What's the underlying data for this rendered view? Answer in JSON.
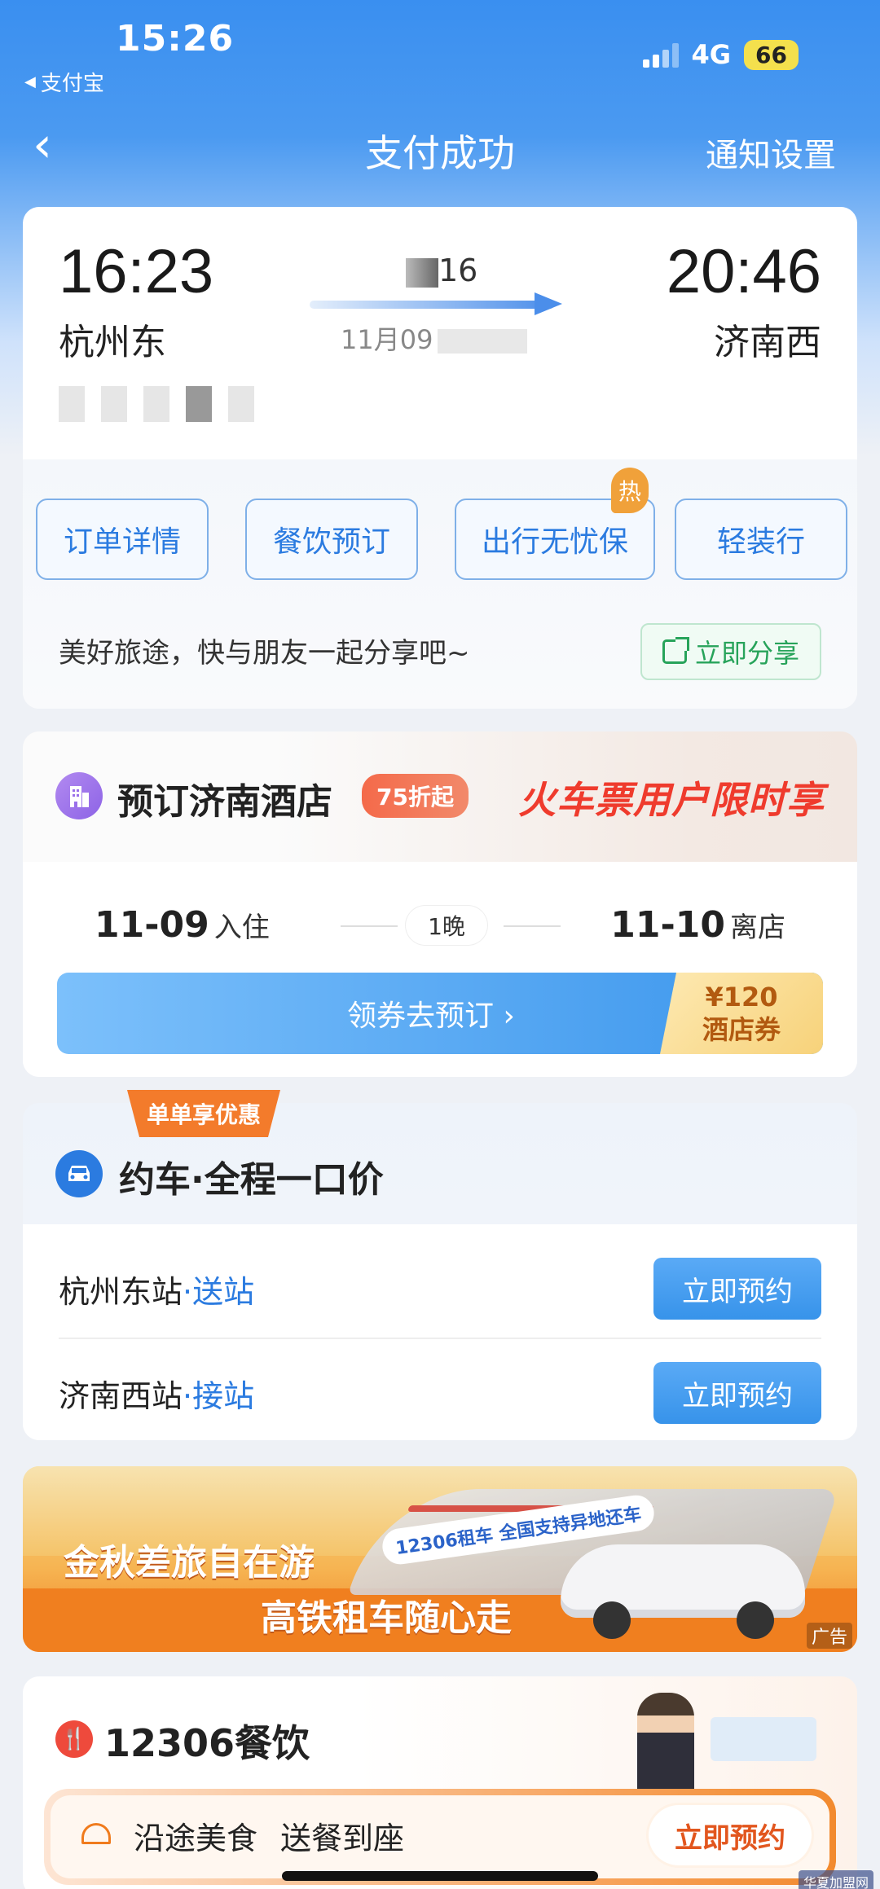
{
  "status_bar": {
    "time": "15:26",
    "back_app": "支付宝",
    "network": "4G",
    "battery": "66"
  },
  "nav": {
    "back_icon": "chevron-left-icon",
    "title": "支付成功",
    "notify_settings": "通知设置"
  },
  "ticket": {
    "depart_time": "16:23",
    "arrive_time": "20:46",
    "depart_station": "杭州东",
    "arrive_station": "济南西",
    "train_no_visible": "16",
    "date_visible": "11月09"
  },
  "quick_actions": [
    {
      "label": "订单详情"
    },
    {
      "label": "餐饮预订"
    },
    {
      "label": "出行无忧保",
      "badge": "热"
    },
    {
      "label": "轻装行"
    }
  ],
  "share": {
    "text": "美好旅途，快与朋友一起分享吧~",
    "button": "立即分享"
  },
  "hotel": {
    "title": "预订济南酒店",
    "discount": "75折起",
    "promo": "火车票用户限时享",
    "checkin_date": "11-09",
    "checkin_label": "入住",
    "nights": "1晚",
    "checkout_date": "11-10",
    "checkout_label": "离店",
    "coupon_button": "领券去预订 ›",
    "coupon_amount": "¥120",
    "coupon_type": "酒店券"
  },
  "ride": {
    "tag": "单单享优惠",
    "title": "约车·全程一口价",
    "rows": [
      {
        "station": "杭州东站",
        "type": "·送站",
        "button": "立即预约"
      },
      {
        "station": "济南西站",
        "type": "·接站",
        "button": "立即预约"
      }
    ]
  },
  "banner": {
    "line1": "金秋差旅自在游",
    "line2": "高铁租车随心走",
    "tag": "12306租车 全国支持异地还车",
    "ad_label": "广告"
  },
  "food": {
    "title": "12306餐饮",
    "text1": "沿途美食",
    "text2": "送餐到座",
    "button": "立即预约"
  },
  "watermark": "华夏加盟网",
  "colors": {
    "primary_blue": "#2b7be0",
    "header_blue": "#3a8ff0",
    "share_green": "#27a35a",
    "hot_orange": "#f0a13a",
    "promo_red": "#ef3b2d"
  }
}
